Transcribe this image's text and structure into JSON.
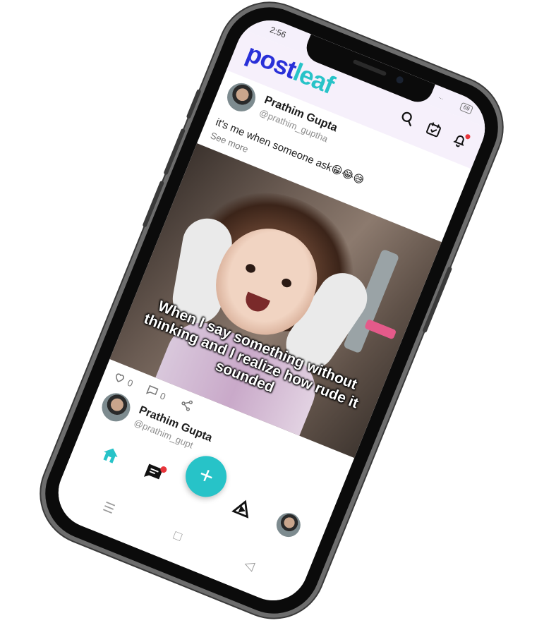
{
  "status_bar": {
    "time": "2:56",
    "signal": "...",
    "battery": "69"
  },
  "app": {
    "logo_part1": "post",
    "logo_part2": "leaf",
    "accent_color": "#27c3c8",
    "brand_color": "#2930d8"
  },
  "header_icons": [
    "search-icon",
    "calendar-check-icon",
    "bell-icon"
  ],
  "post": {
    "author": "Prathim Gupta",
    "handle": "@prathim_guptha",
    "caption": "it's me when someone ask😁😂😅",
    "see_more": "See more",
    "image_text": "When I say something without thinking and I realize how rude it sounded",
    "likes": "0",
    "comments": "0"
  },
  "post2": {
    "author": "Prathim Gupta",
    "handle": "@prathim_gupt"
  },
  "bottom_nav": {
    "fab_label": "+",
    "tabs": [
      "home-icon",
      "chat-icon",
      "add-button",
      "video-icon",
      "profile-avatar"
    ]
  },
  "system_nav": [
    "☰",
    "□",
    "◁"
  ]
}
